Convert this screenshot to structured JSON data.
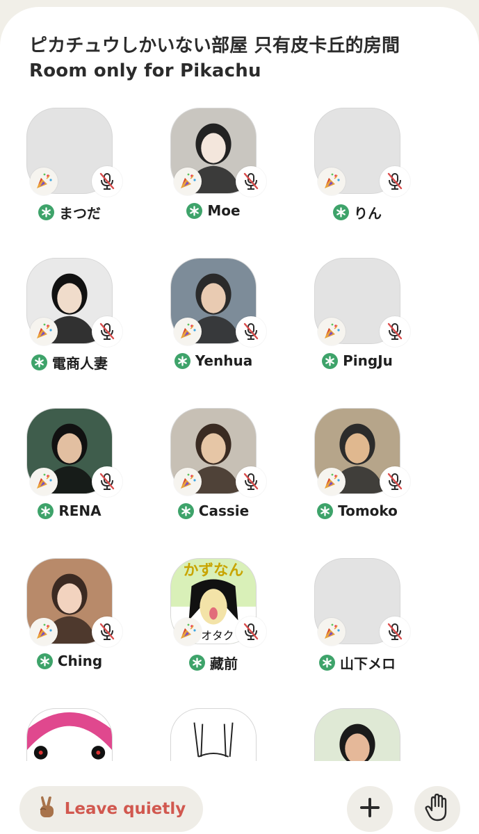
{
  "room": {
    "title": "ピカチュウしかいない部屋 只有皮卡丘的房間 Room only for Pikachu"
  },
  "speakers": [
    {
      "name": "まつだ",
      "avatar": "placeholder",
      "new_member": true,
      "muted": true
    },
    {
      "name": "Moe",
      "avatar": "photo",
      "new_member": true,
      "muted": true
    },
    {
      "name": "りん",
      "avatar": "placeholder",
      "new_member": true,
      "muted": true
    },
    {
      "name": "電商人妻",
      "avatar": "photo",
      "new_member": true,
      "muted": true
    },
    {
      "name": "Yenhua",
      "avatar": "photo",
      "new_member": true,
      "muted": true
    },
    {
      "name": "PingJu",
      "avatar": "placeholder",
      "new_member": true,
      "muted": true
    },
    {
      "name": "RENA",
      "avatar": "photo",
      "new_member": true,
      "muted": true
    },
    {
      "name": "Cassie",
      "avatar": "photo",
      "new_member": true,
      "muted": true
    },
    {
      "name": "Tomoko",
      "avatar": "photo",
      "new_member": true,
      "muted": true
    },
    {
      "name": "Ching",
      "avatar": "photo",
      "new_member": true,
      "muted": true
    },
    {
      "name": "藏前",
      "avatar": "drawing",
      "drawing_text": "かずなん",
      "drawing_caption": "オタク",
      "new_member": true,
      "muted": true
    },
    {
      "name": "山下メロ",
      "avatar": "placeholder",
      "new_member": true,
      "muted": true
    },
    {
      "name": "",
      "avatar": "illustration"
    },
    {
      "name": "",
      "avatar": "sketch"
    },
    {
      "name": "",
      "avatar": "photo"
    }
  ],
  "icons": {
    "new_member": "new-member-asterisk-icon",
    "muted": "microphone-muted-icon",
    "party": "party-popper-icon",
    "leave": "victory-hand-emoji",
    "add": "plus-icon",
    "raise_hand": "raised-hand-icon"
  },
  "footer": {
    "leave_label": "Leave quietly"
  },
  "colors": {
    "background": "#f1efe8",
    "new_member_badge": "#3ea36a",
    "leave_text": "#d1584f",
    "button_bg": "#efede7",
    "mute_slash": "#d94a4a"
  }
}
